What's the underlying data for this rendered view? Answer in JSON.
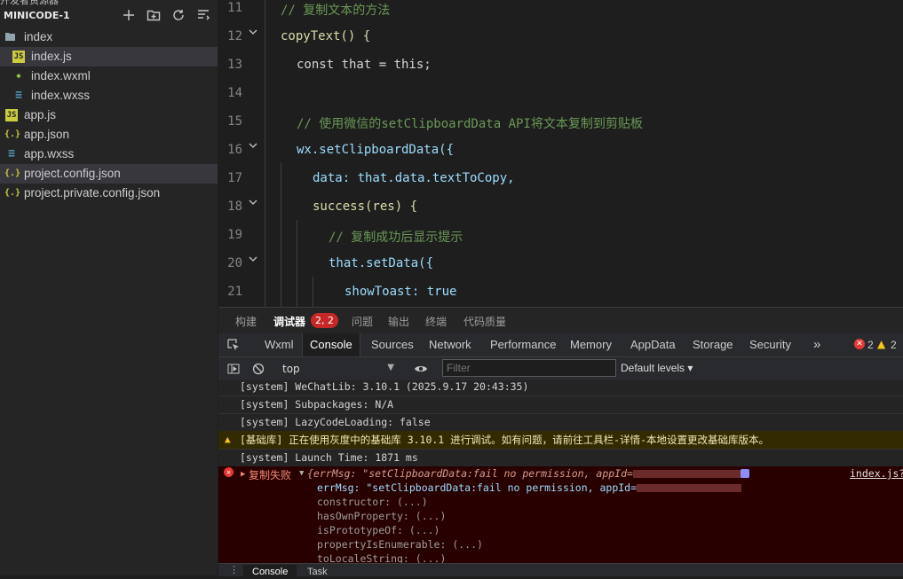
{
  "sidebar": {
    "top_text": "开发者资源器",
    "project_name": "MINICODE-1",
    "actions": [
      "new-file-icon",
      "new-folder-icon",
      "refresh-icon",
      "collapse-icon"
    ],
    "items": [
      {
        "label": "index",
        "icon": "folder-open-icon",
        "indent": 0
      },
      {
        "label": "index.js",
        "icon": "js-icon",
        "indent": 1,
        "selected": true
      },
      {
        "label": "index.wxml",
        "icon": "wxml-icon",
        "indent": 1
      },
      {
        "label": "index.wxss",
        "icon": "css-icon",
        "indent": 1
      },
      {
        "label": "app.js",
        "icon": "js-icon",
        "indent": 0
      },
      {
        "label": "app.json",
        "icon": "json-icon",
        "indent": 0
      },
      {
        "label": "app.wxss",
        "icon": "css-icon",
        "indent": 0
      },
      {
        "label": "project.config.json",
        "icon": "json-icon",
        "indent": 0,
        "selected": true
      },
      {
        "label": "project.private.config.json",
        "icon": "json-icon",
        "indent": 0
      }
    ]
  },
  "editor": {
    "line_numbers": [
      "11",
      "12",
      "13",
      "14",
      "15",
      "16",
      "17",
      "18",
      "19",
      "20",
      "21"
    ],
    "lines": [
      "// 复制文本的方法",
      "copyText() {",
      "const that = this;",
      "",
      "// 使用微信的setClipboardData API将文本复制到剪贴板",
      "wx.setClipboardData({",
      "data: that.data.textToCopy,",
      "success(res) {",
      "// 复制成功后显示提示",
      "that.setData({",
      "showToast: true"
    ]
  },
  "panel_tabs": {
    "build": "构建",
    "debugger": "调试器",
    "debugger_badge": "2, 2",
    "issues": "问题",
    "output": "输出",
    "terminal": "终端",
    "code_quality": "代码质量"
  },
  "devtools_tabs": [
    "Wxml",
    "Console",
    "Sources",
    "Network",
    "Performance",
    "Memory",
    "AppData",
    "Storage",
    "Security"
  ],
  "devtools_more": "»",
  "counts": {
    "errors": "2",
    "warnings": "2"
  },
  "toolbar": {
    "context": "top",
    "filter_placeholder": "Filter",
    "levels": "Default levels ▾"
  },
  "console": {
    "lines": [
      "[system] WeChatLib: 3.10.1 (2025.9.17 20:43:35)",
      "[system] Subpackages: N/A",
      "[system] LazyCodeLoading: false"
    ],
    "warning": "[基础库] 正在使用灰度中的基础库 3.10.1 进行调试。如有问题，请前往工具栏-详情-本地设置更改基础库版本。",
    "launch": "[system] Launch Time: 1871 ms",
    "error_label": "复制失败",
    "error_head": "{errMsg: \"setClipboardData:fail no permission, appId=",
    "error_source": "index.js?",
    "error_props": [
      "errMsg: \"setClipboardData:fail no permission, appId=",
      "constructor: (...)",
      "hasOwnProperty: (...)",
      "isPrototypeOf: (...)",
      "propertyIsEnumerable: (...)",
      "toLocaleString: (...)"
    ]
  },
  "bottom_tabs": [
    "Console",
    "Task"
  ],
  "colors": {
    "accent": "#0e639c",
    "error_bg": "#290000",
    "warning_bg": "#332b00",
    "badge": "#c62828"
  }
}
